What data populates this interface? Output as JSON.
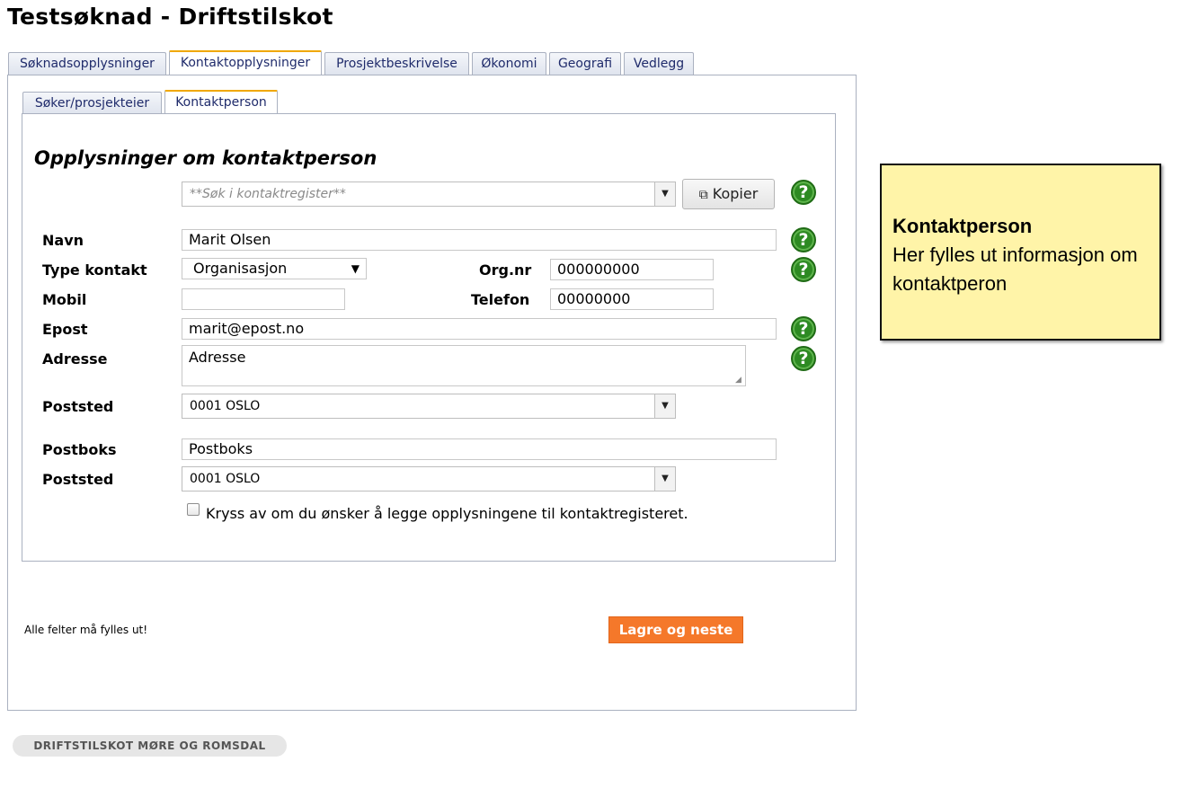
{
  "page": {
    "title": "Testsøknad - Driftstilskot"
  },
  "tabs": [
    {
      "label": "Søknadsopplysninger"
    },
    {
      "label": "Kontaktopplysninger"
    },
    {
      "label": "Prosjektbeskrivelse"
    },
    {
      "label": "Økonomi"
    },
    {
      "label": "Geografi"
    },
    {
      "label": "Vedlegg"
    }
  ],
  "subtabs": [
    {
      "label": "Søker/prosjekteier"
    },
    {
      "label": "Kontaktperson"
    }
  ],
  "form": {
    "section_title": "Opplysninger om kontaktperson",
    "search": {
      "placeholder": "**Søk i kontaktregister**"
    },
    "kopier_label": "Kopier",
    "labels": {
      "navn": "Navn",
      "type_kontakt": "Type kontakt",
      "org_nr": "Org.nr",
      "mobil": "Mobil",
      "telefon": "Telefon",
      "epost": "Epost",
      "adresse": "Adresse",
      "poststed": "Poststed",
      "postboks": "Postboks",
      "poststed2": "Poststed"
    },
    "values": {
      "navn": "Marit Olsen",
      "type_kontakt": "Organisasjon",
      "org_nr": "000000000",
      "mobil": "",
      "telefon": "00000000",
      "epost": "marit@epost.no",
      "adresse": "Adresse",
      "poststed": "0001 OSLO",
      "postboks": "Postboks",
      "poststed2": "0001 OSLO"
    },
    "checkbox_label": "Kryss av om du ønsker å legge opplysningene til kontaktregisteret.",
    "required_note": "Alle felter må fylles ut!",
    "submit_label": "Lagre og neste"
  },
  "help_note": {
    "heading": "Kontaktperson",
    "body": "Her fylles ut informasjon om kontaktperon"
  },
  "footer": {
    "label": "DRIFTSTILSKOT MØRE OG ROMSDAL"
  },
  "colors": {
    "accent_tab": "#f0a800",
    "submit_button": "#f5782a",
    "help_icon": "#2d8a22",
    "note_bg": "#fff4a8"
  }
}
